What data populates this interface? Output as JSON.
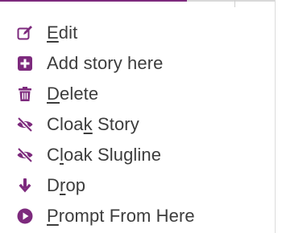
{
  "theme": {
    "accent": "#7d2a7d",
    "text": "#3c3c3c"
  },
  "menu": {
    "items": [
      {
        "label": "Edit",
        "mnemonic": "E",
        "icon": "edit-icon"
      },
      {
        "label": "Add story here",
        "mnemonic": "",
        "icon": "plus-square-icon"
      },
      {
        "label": "Delete",
        "mnemonic": "D",
        "icon": "trash-icon"
      },
      {
        "label": "Cloak Story",
        "mnemonic": "k",
        "icon": "eye-slash-icon"
      },
      {
        "label": "Cloak Slugline",
        "mnemonic": "l",
        "icon": "eye-slash-icon"
      },
      {
        "label": "Drop",
        "mnemonic": "r",
        "icon": "arrow-down-icon"
      },
      {
        "label": "Prompt From Here",
        "mnemonic": "P",
        "icon": "play-circle-icon"
      }
    ]
  }
}
